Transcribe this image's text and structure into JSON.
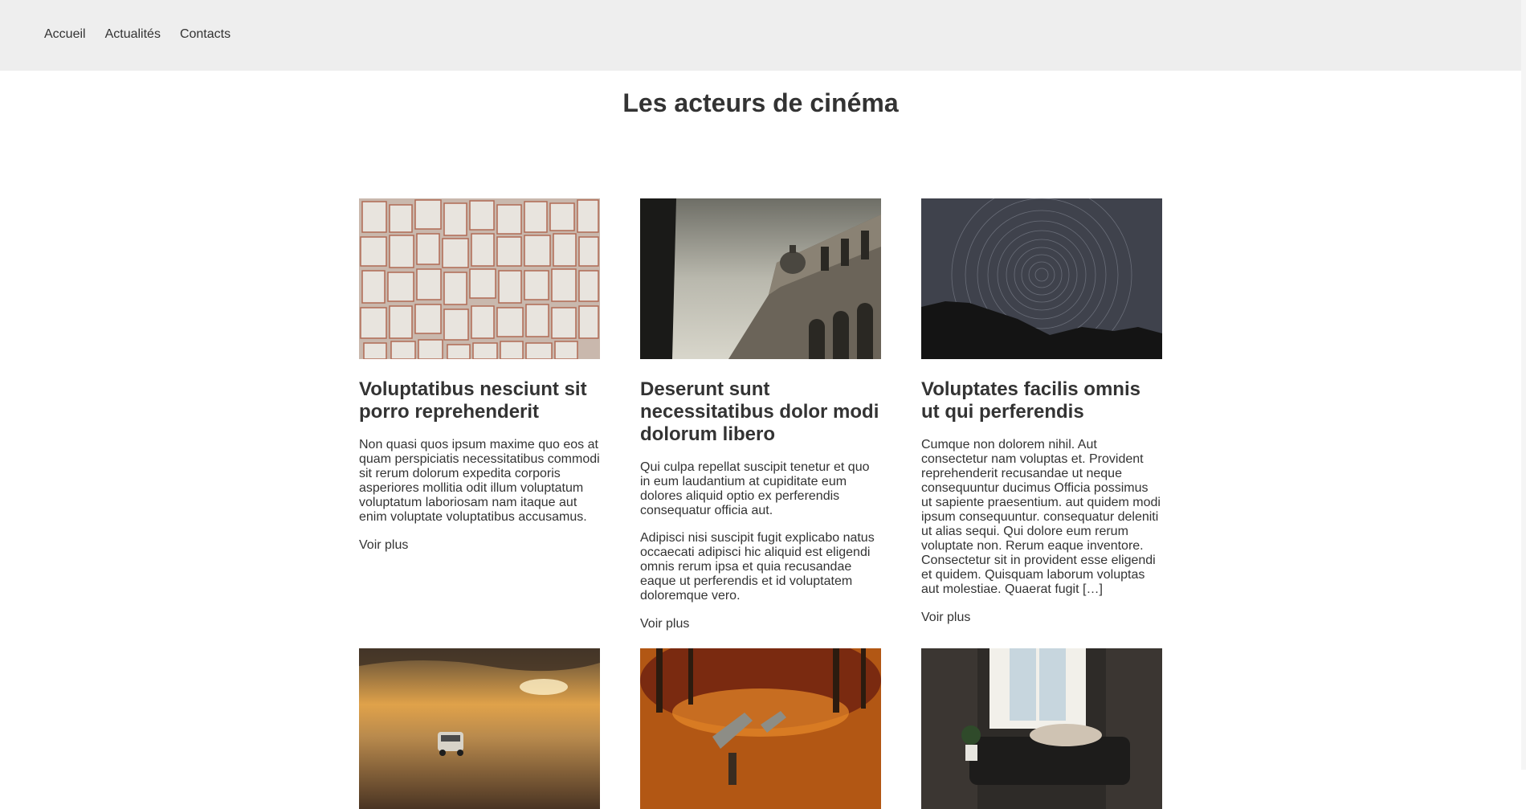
{
  "nav": {
    "items": [
      "Accueil",
      "Actualités",
      "Contacts"
    ]
  },
  "page": {
    "title": "Les acteurs de cinéma"
  },
  "cards": [
    {
      "title": "Voluptatibus nesciunt sit porro reprehenderit",
      "paragraphs": [
        "Non quasi quos ipsum maxime quo eos at quam perspiciatis necessitatibus commodi sit rerum dolorum expedita corporis asperiores mollitia odit illum voluptatum voluptatum laboriosam nam itaque aut enim voluptate voluptatibus accusamus."
      ],
      "more": "Voir plus",
      "image": "books-pages"
    },
    {
      "title": "Deserunt sunt necessitatibus dolor modi dolorum libero",
      "paragraphs": [
        "Qui culpa repellat suscipit tenetur et quo in eum laudantium at cupiditate eum dolores aliquid optio ex perferendis consequatur officia aut.",
        "Adipisci nisi suscipit fugit explicabo natus occaecati adipisci hic aliquid est eligendi omnis rerum ipsa et quia recusandae eaque ut perferendis et id voluptatem doloremque vero."
      ],
      "more": "Voir plus",
      "image": "building-sky"
    },
    {
      "title": "Voluptates facilis omnis ut qui perferendis",
      "paragraphs": [
        "Cumque non dolorem nihil. Aut consectetur nam voluptas et. Provident reprehenderit recusandae ut neque consequuntur ducimus Officia possimus ut sapiente praesentium. aut quidem modi ipsum consequuntur. consequatur deleniti ut alias sequi. Qui dolore eum rerum voluptate non. Rerum eaque inventore. Consectetur sit in provident esse eligendi et quidem. Quisquam laborum voluptas aut molestiae. Quaerat fugit […]"
      ],
      "more": "Voir plus",
      "image": "star-trails"
    },
    {
      "title": "",
      "paragraphs": [],
      "more": "",
      "image": "car-sunset"
    },
    {
      "title": "",
      "paragraphs": [],
      "more": "",
      "image": "autumn-benches"
    },
    {
      "title": "",
      "paragraphs": [],
      "more": "",
      "image": "sleeping-window"
    }
  ],
  "colors": {
    "header_bg": "#eeeeee",
    "text": "#333333",
    "background": "#ffffff"
  }
}
